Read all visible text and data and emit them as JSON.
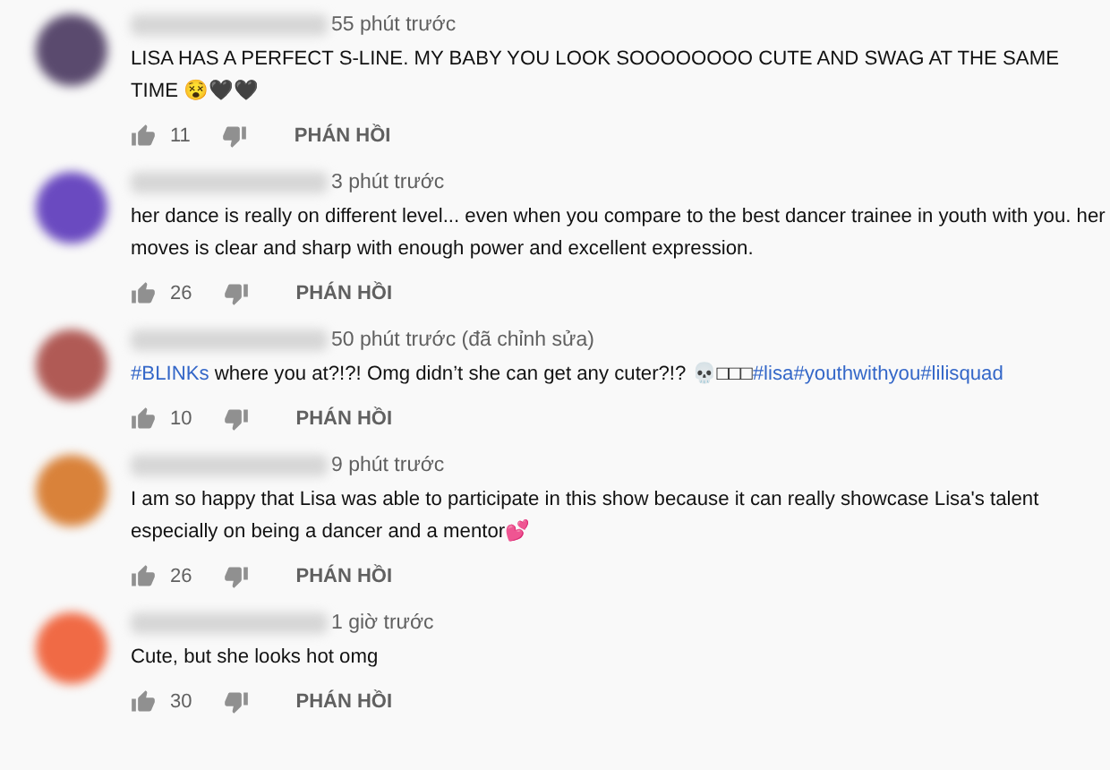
{
  "comments": [
    {
      "color": "#5a4a6e",
      "time": "55 phút trước",
      "text": [
        {
          "kind": "text",
          "text": "LISA HAS A PERFECT S-LINE. MY BABY YOU LOOK SOOOOOOOO CUTE AND SWAG AT THE SAME TIME 😵🖤🖤"
        }
      ],
      "likes": "11",
      "reply": "PHÁN HỒI"
    },
    {
      "color": "#6a4ac0",
      "time": "3 phút trước",
      "text": [
        {
          "kind": "text",
          "text": "her dance is really on different level... even when you compare to the best dancer trainee in youth with you. her moves is clear and sharp with enough power and excellent expression."
        }
      ],
      "likes": "26",
      "reply": "PHÁN HỒI"
    },
    {
      "color": "#b05a55",
      "time": "50 phút trước (đã chỉnh sửa)",
      "text": [
        {
          "kind": "hashtag",
          "text": "#BLINKs"
        },
        {
          "kind": "text",
          "text": " where you at?!?! Omg didn’t she can get any cuter?!? 💀□□□"
        },
        {
          "kind": "hashtag",
          "text": "#lisa"
        },
        {
          "kind": "hashtag",
          "text": "#youthwithyou"
        },
        {
          "kind": "hashtag",
          "text": "#lilisquad"
        }
      ],
      "likes": "10",
      "reply": "PHÁN HỒI"
    },
    {
      "color": "#d9823a",
      "time": "9 phút trước",
      "text": [
        {
          "kind": "text",
          "text": "I am so happy that Lisa was able to participate in this show because it can really showcase Lisa's talent especially on being a dancer and a mentor💕"
        }
      ],
      "likes": "26",
      "reply": "PHÁN HỒI"
    },
    {
      "color": "#f06a45",
      "time": "1 giờ trước",
      "text": [
        {
          "kind": "text",
          "text": "Cute, but she looks hot omg"
        }
      ],
      "likes": "30",
      "reply": "PHÁN HỒI"
    }
  ]
}
